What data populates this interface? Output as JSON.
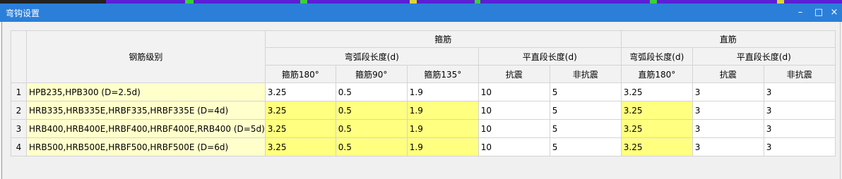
{
  "window": {
    "title": "弯钩设置",
    "minimize_label": "–",
    "maximize_label": "□",
    "close_label": "×"
  },
  "header": {
    "grade_label": "钢筋级别",
    "stirrup_group": "箍筋",
    "straight_group": "直筋",
    "stirrup_arc": "弯弧段长度(d)",
    "stirrup_flat": "平直段长度(d)",
    "straight_arc": "弯弧段长度(d)",
    "straight_flat": "平直段长度(d)",
    "col_stirrup180": "箍筋180°",
    "col_stirrup90": "箍筋90°",
    "col_stirrup135": "箍筋135°",
    "col_seismic": "抗震",
    "col_nonseismic": "非抗震",
    "col_straight180": "直筋180°",
    "col_seismic2": "抗震",
    "col_nonseismic2": "非抗震"
  },
  "rows": [
    {
      "num": "1",
      "grade": "HPB235,HPB300 (D=2.5d)",
      "s180": "3.25",
      "s90": "0.5",
      "s135": "1.9",
      "seis": "10",
      "nonseis": "5",
      "st180": "3.25",
      "seis2": "3",
      "nonseis2": "3"
    },
    {
      "num": "2",
      "grade": "HRB335,HRB335E,HRBF335,HRBF335E (D=4d)",
      "s180": "3.25",
      "s90": "0.5",
      "s135": "1.9",
      "seis": "10",
      "nonseis": "5",
      "st180": "3.25",
      "seis2": "3",
      "nonseis2": "3"
    },
    {
      "num": "3",
      "grade": "HRB400,HRB400E,HRBF400,HRBF400E,RRB400 (D=5d)",
      "s180": "3.25",
      "s90": "0.5",
      "s135": "1.9",
      "seis": "10",
      "nonseis": "5",
      "st180": "3.25",
      "seis2": "3",
      "nonseis2": "3"
    },
    {
      "num": "4",
      "grade": "HRB500,HRB500E,HRBF500,HRBF500E (D=6d)",
      "s180": "3.25",
      "s90": "0.5",
      "s135": "1.9",
      "seis": "10",
      "nonseis": "5",
      "st180": "3.25",
      "seis2": "3",
      "nonseis2": "3"
    }
  ],
  "colors": {
    "titlebar": "#2b7fd9",
    "highlight": "#ffff80",
    "grade_cell": "#ffffcc"
  }
}
